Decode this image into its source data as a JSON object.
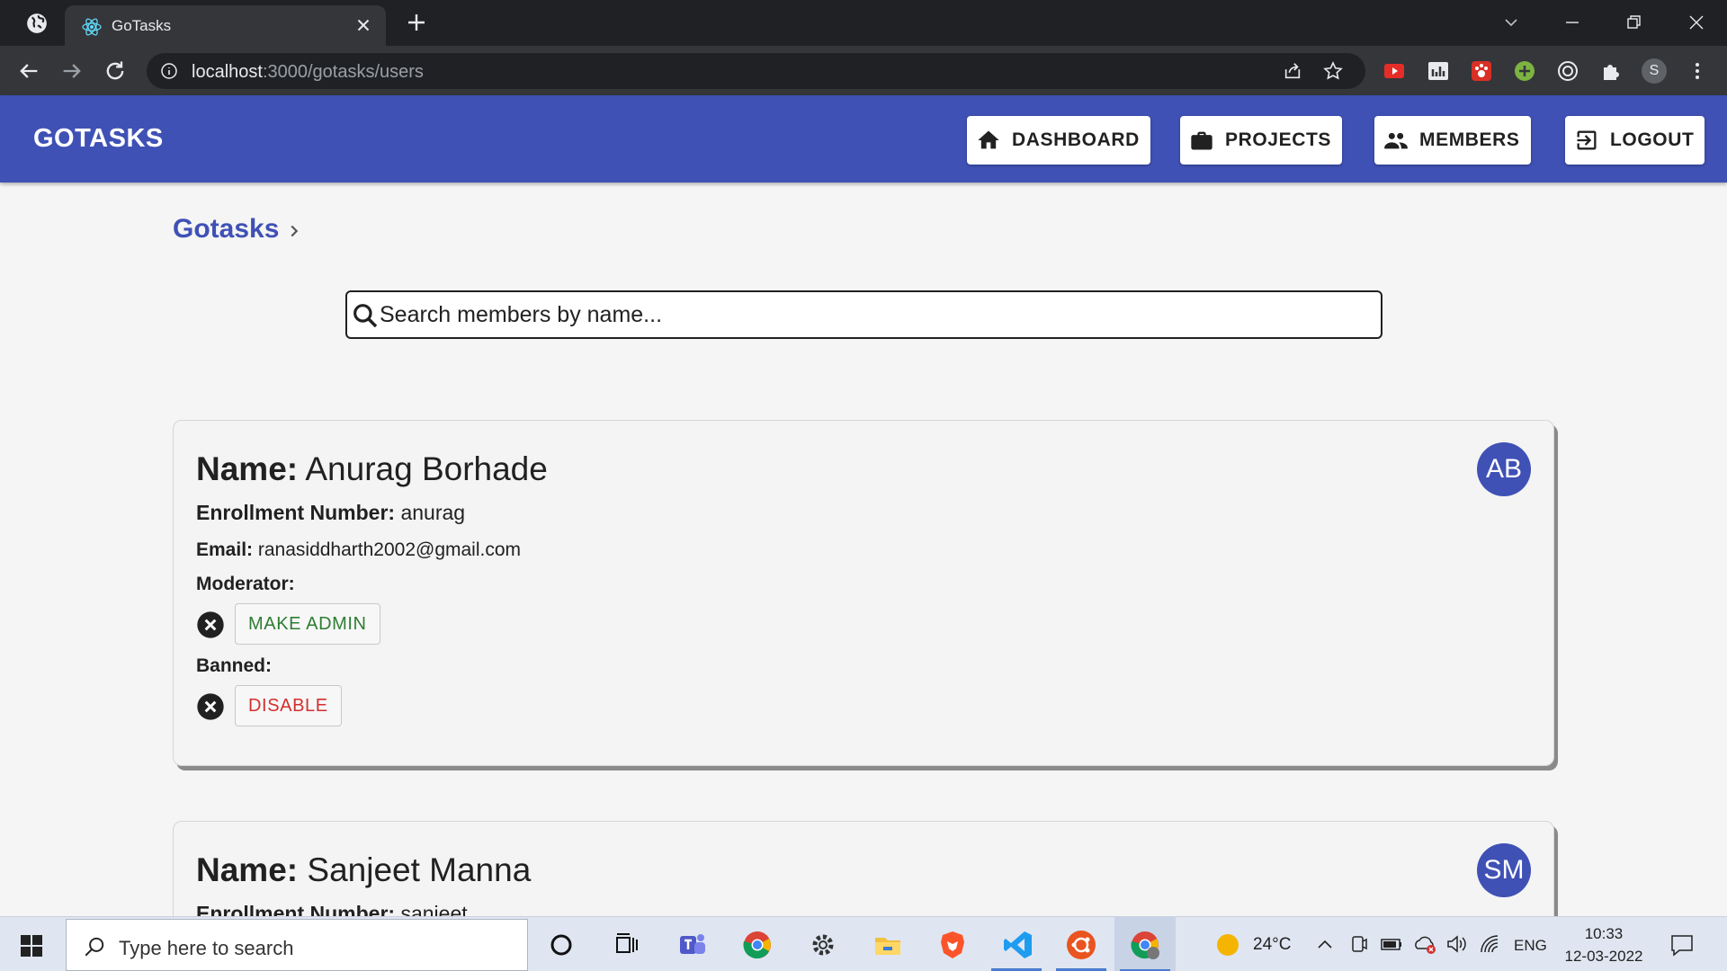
{
  "browser": {
    "tab_title": "GoTasks",
    "url_host": "localhost",
    "url_path": ":3000/gotasks/users",
    "profile_initial": "S"
  },
  "appbar": {
    "brand": "GOTASKS",
    "nav": [
      {
        "label": "DASHBOARD",
        "icon": "home-icon"
      },
      {
        "label": "PROJECTS",
        "icon": "briefcase-icon"
      },
      {
        "label": "MEMBERS",
        "icon": "people-icon"
      },
      {
        "label": "LOGOUT",
        "icon": "logout-icon"
      }
    ]
  },
  "breadcrumb": {
    "root": "Gotasks"
  },
  "search": {
    "placeholder": "Search members by name..."
  },
  "labels": {
    "name": "Name:",
    "enrollment": "Enrollment Number:",
    "email": "Email:",
    "moderator": "Moderator:",
    "banned": "Banned:"
  },
  "members": [
    {
      "name": "Anurag Borhade",
      "initials": "AB",
      "enrollment": "anurag",
      "email": "ranasiddharth2002@gmail.com",
      "moderator": false,
      "moderator_action": "MAKE ADMIN",
      "banned": false,
      "banned_action": "DISABLE"
    },
    {
      "name": "Sanjeet Manna",
      "initials": "SM",
      "enrollment": "sanjeet"
    }
  ],
  "taskbar": {
    "search_placeholder": "Type here to search",
    "temperature": "24°C",
    "language": "ENG",
    "time": "10:33",
    "date": "12-03-2022"
  },
  "colors": {
    "primary": "#3f51b5",
    "success": "#2e7d32",
    "danger": "#d32f2f"
  }
}
